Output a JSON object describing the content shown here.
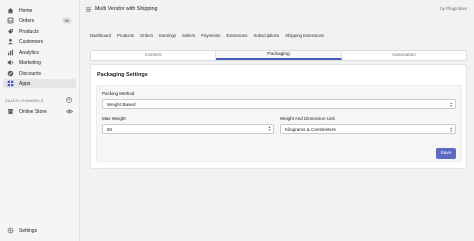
{
  "sidebar": {
    "items": [
      {
        "label": "Home",
        "icon": "home-icon"
      },
      {
        "label": "Orders",
        "icon": "orders-icon",
        "badge": "30"
      },
      {
        "label": "Products",
        "icon": "products-icon"
      },
      {
        "label": "Customers",
        "icon": "customers-icon"
      },
      {
        "label": "Analytics",
        "icon": "analytics-icon"
      },
      {
        "label": "Marketing",
        "icon": "marketing-icon"
      },
      {
        "label": "Discounts",
        "icon": "discounts-icon"
      },
      {
        "label": "Apps",
        "icon": "apps-icon",
        "active": true
      }
    ],
    "sales_channels_label": "SALES CHANNELS",
    "channel": {
      "label": "Online Store",
      "icon": "online-store-icon"
    },
    "settings": {
      "label": "Settings",
      "icon": "settings-icon"
    }
  },
  "header": {
    "app_title": "Multi Vendor with Shipping",
    "by": "by Pluginhive"
  },
  "app_nav": [
    "Dashboard",
    "Products",
    "Orders",
    "Earnings",
    "Sellers",
    "Payments",
    "Extensions",
    "Subscriptions",
    "Shipping Extensions"
  ],
  "tabs": [
    {
      "label": "Carriers"
    },
    {
      "label": "Packaging",
      "active": true
    },
    {
      "label": "Automation"
    }
  ],
  "packaging": {
    "title": "Packaging Settings",
    "method_label": "Packing Method",
    "method_value": "Weight Based",
    "max_weight_label": "Max Weight",
    "max_weight_value": "50",
    "units_label": "Weight And Dimension Unit",
    "units_value": "Kilograms & Centimeters"
  },
  "save_label": "Save",
  "colors": {
    "accent": "#5c6ac4",
    "active_tab_border": "#4959bd"
  }
}
